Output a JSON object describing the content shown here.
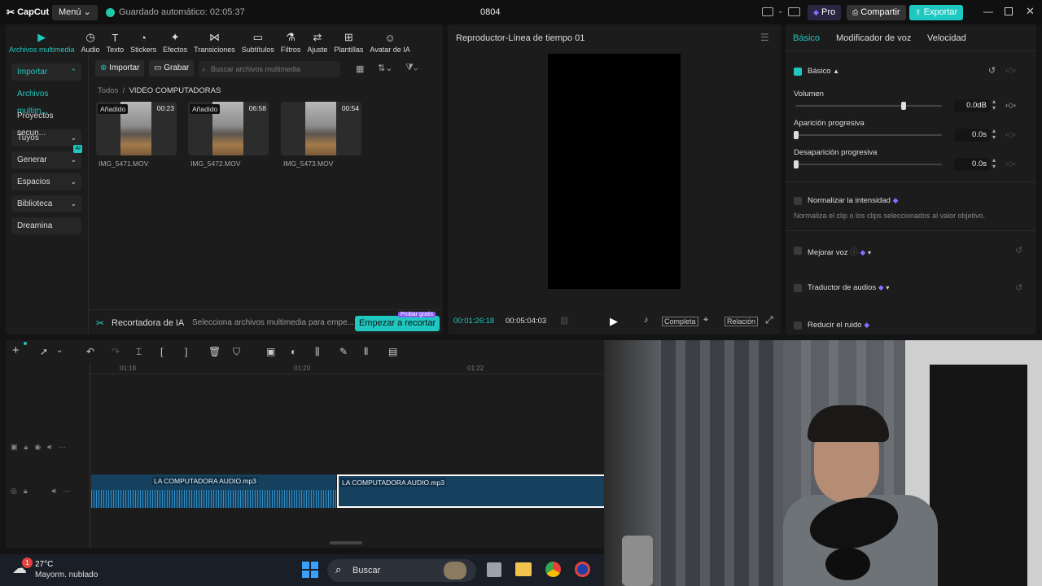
{
  "titlebar": {
    "logo": "CapCut",
    "menu_label": "Menú",
    "autosave": "Guardado automático: 02:05:37",
    "project_name": "0804",
    "pro_label": "Pro",
    "share_label": "Compartir",
    "export_label": "Exportar"
  },
  "tabs": [
    {
      "label": "Archivos multimedia",
      "icon": "media-icon"
    },
    {
      "label": "Audio",
      "icon": "audio-icon"
    },
    {
      "label": "Texto",
      "icon": "text-icon"
    },
    {
      "label": "Stickers",
      "icon": "sticker-icon"
    },
    {
      "label": "Efectos",
      "icon": "effects-icon"
    },
    {
      "label": "Transiciones",
      "icon": "transition-icon"
    },
    {
      "label": "Subtítulos",
      "icon": "subtitles-icon"
    },
    {
      "label": "Filtros",
      "icon": "filter-icon"
    },
    {
      "label": "Ajuste",
      "icon": "adjust-icon"
    },
    {
      "label": "Plantillas",
      "icon": "templates-icon"
    },
    {
      "label": "Avatar de IA",
      "icon": "ai-avatar-icon"
    }
  ],
  "sidebar": {
    "items": [
      {
        "label": "Importar"
      },
      {
        "label": "Archivos multim..."
      },
      {
        "label": "Proyectos secun..."
      },
      {
        "label": "Tuyos"
      },
      {
        "label": "Generar",
        "badge": "AI"
      },
      {
        "label": "Espacios"
      },
      {
        "label": "Biblioteca"
      },
      {
        "label": "Dreamina"
      }
    ]
  },
  "media": {
    "import_label": "Importar",
    "record_label": "Grabar",
    "search_placeholder": "Buscar archivos multimedia",
    "crumb_all": "Todos",
    "crumb_sep": "/",
    "crumb_folder": "VIDEO COMPUTADORAS",
    "files": [
      {
        "name": "IMG_5471.MOV",
        "duration": "00:23",
        "badge": "Añadido"
      },
      {
        "name": "IMG_5472.MOV",
        "duration": "06:58",
        "badge": "Añadido"
      },
      {
        "name": "IMG_5473.MOV",
        "duration": "00:54",
        "badge": ""
      }
    ]
  },
  "ai_cutter": {
    "title": "Recortadora de IA",
    "hint": "Selecciona archivos multimedia para empe...",
    "button": "Empezar a recortar",
    "free_tag": "Probar gratis"
  },
  "player": {
    "title": "Reproductor-Línea de tiempo 01",
    "current_time": "00:01:26:18",
    "total_time": "00:05:04:03",
    "full_label": "Completa",
    "ratio_label": "Relación"
  },
  "rightpanel": {
    "tabs": [
      "Básico",
      "Modificador de voz",
      "Velocidad"
    ],
    "section_basic": "Básico",
    "volume_label": "Volumen",
    "volume_value": "0.0dB",
    "fade_in_label": "Aparición progresiva",
    "fade_in_value": "0.0s",
    "fade_out_label": "Desaparición progresiva",
    "fade_out_value": "0.0s",
    "normalize_label": "Normalizar la intensidad",
    "normalize_desc": "Normaliza el clip o los clips seleccionados al valor objetivo.",
    "enhance_label": "Mejorar voz",
    "translate_label": "Traductor de audios",
    "denoise_label": "Reducir el ruido"
  },
  "timeline": {
    "ruler": [
      "01:18",
      "01:20",
      "01:22"
    ],
    "clips": [
      {
        "label": "LA COMPUTADORA AUDIO.mp3"
      },
      {
        "label": "LA COMPUTADORA AUDIO.mp3"
      }
    ]
  },
  "taskbar": {
    "temperature": "27°C",
    "weather": "Mayorm. nublado",
    "notification_count": "1",
    "search_label": "Buscar"
  },
  "colors": {
    "accent": "#1ec7c0",
    "export": "#1ec7c0",
    "clip": "#15405e"
  }
}
